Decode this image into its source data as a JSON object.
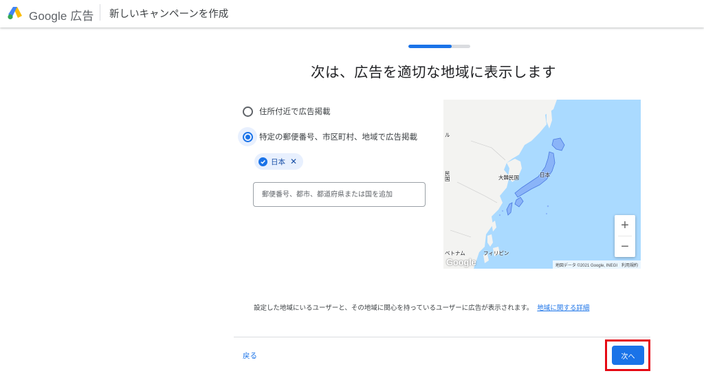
{
  "header": {
    "brand": "Google 広告",
    "page_title": "新しいキャンペーンを作成"
  },
  "progress": {
    "fraction": 0.7
  },
  "main": {
    "title": "次は、広告を適切な地域に表示します"
  },
  "options": [
    {
      "label": "住所付近で広告掲載",
      "selected": false
    },
    {
      "label": "特定の郵便番号、市区町村、地域で広告掲載",
      "selected": true
    }
  ],
  "chip": {
    "label": "日本",
    "close": "✕"
  },
  "location_input": {
    "placeholder": "郵便番号、都市、都道府県または国を追加",
    "value": ""
  },
  "map": {
    "labels": {
      "korea": "大韓民国",
      "japan": "日本",
      "vietnam": "ベトナム",
      "philippines": "フィリピン",
      "left_edge_top": "ル",
      "left_edge_mid": "民\n国"
    },
    "zoom_in": "+",
    "zoom_out": "−",
    "attribution": "地図データ ©2021 Google, INEGI",
    "terms": "利用規約",
    "logo": "Google"
  },
  "footer": {
    "info": "設定した地域にいるユーザーと、その地域に関心を持っているユーザーに広告が表示されます。",
    "info_link": "地域に関する詳細",
    "back": "戻る",
    "next": "次へ"
  },
  "colors": {
    "accent": "#1a73e8",
    "highlight": "#e50914",
    "map_water": "#aadaff",
    "map_land": "#f3f3f1",
    "japan_fill": "#8ab4f8"
  }
}
